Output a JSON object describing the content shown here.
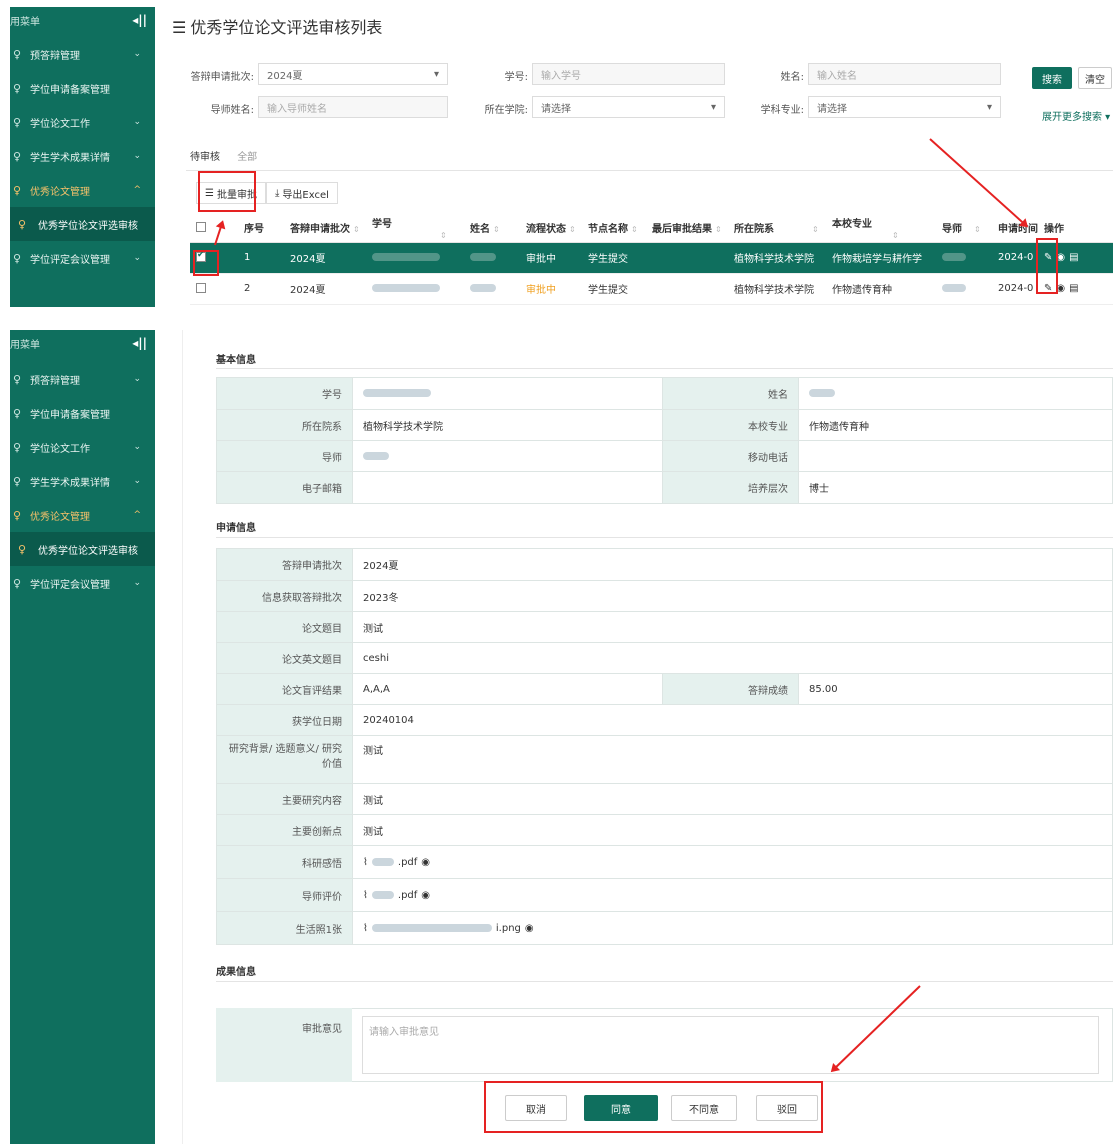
{
  "sidebar": {
    "header": "用菜单",
    "collapse": "◂||",
    "items": [
      {
        "label": "预答辩管理",
        "chev": "⌄"
      },
      {
        "label": "学位申请备案管理",
        "chev": ""
      },
      {
        "label": "学位论文工作",
        "chev": "⌄"
      },
      {
        "label": "学生学术成果详情",
        "chev": "⌄"
      },
      {
        "label": "优秀论文管理",
        "chev": "^"
      },
      {
        "label": "优秀学位论文评选审核",
        "chev": ""
      },
      {
        "label": "学位评定会议管理",
        "chev": "⌄"
      }
    ]
  },
  "page_title": "优秀学位论文评选审核列表",
  "filters": {
    "batch_label": "答辩申请批次:",
    "batch_value": "2024夏",
    "xuehao_label": "学号:",
    "xuehao_placeholder": "输入学号",
    "name_label": "姓名:",
    "name_placeholder": "输入姓名",
    "tutor_label": "导师姓名:",
    "tutor_placeholder": "输入导师姓名",
    "college_label": "所在学院:",
    "college_value": "请选择",
    "major_label": "学科专业:",
    "major_value": "请选择",
    "search": "搜索",
    "clear": "清空",
    "more": "展开更多搜索 ▾"
  },
  "tabs": [
    "待审核",
    "全部"
  ],
  "toolbar": {
    "batch_approve": "批量审批",
    "export": "导出Excel"
  },
  "table": {
    "headers": [
      "序号",
      "答辩申请批次",
      "学号",
      "姓名",
      "流程状态",
      "节点名称",
      "最后审批结果",
      "所在院系",
      "本校专业",
      "导师",
      "申请时间",
      "操作"
    ],
    "rows": [
      {
        "no": "1",
        "batch": "2024夏",
        "status": "审批中",
        "node": "学生提交",
        "result": "",
        "college": "植物科学技术学院",
        "major": "作物栽培学与耕作学",
        "time": "2024-0"
      },
      {
        "no": "2",
        "batch": "2024夏",
        "status": "审批中",
        "node": "学生提交",
        "result": "",
        "college": "植物科学技术学院",
        "major": "作物遗传育种",
        "time": "2024-0"
      }
    ]
  },
  "detail": {
    "basic_title": "基本信息",
    "basic": {
      "xuehao": "学号",
      "name": "姓名",
      "college": "所在院系",
      "college_val": "植物科学技术学院",
      "major": "本校专业",
      "major_val": "作物遗传育种",
      "tutor": "导师",
      "phone": "移动电话",
      "email": "电子邮箱",
      "level": "培养层次",
      "level_val": "博士"
    },
    "apply_title": "申请信息",
    "apply": {
      "batch": "答辩申请批次",
      "batch_val": "2024夏",
      "info_batch": "信息获取答辩批次",
      "info_batch_val": "2023冬",
      "topic": "论文题目",
      "topic_val": "测试",
      "en_topic": "论文英文题目",
      "en_topic_val": "ceshi",
      "blind": "论文盲评结果",
      "blind_val": "A,A,A",
      "score": "答辩成绩",
      "score_val": "85.00",
      "degree_date": "获学位日期",
      "degree_date_val": "20240104",
      "background": "研究背景/ 选题意义/ 研究价值",
      "background_val": "测试",
      "content": "主要研究内容",
      "content_val": "测试",
      "innovation": "主要创新点",
      "innovation_val": "测试",
      "feeling": "科研感悟",
      "feeling_file": ".pdf",
      "tutor_eval": "导师评价",
      "tutor_eval_file": ".pdf",
      "photo": "生活照1张",
      "photo_file": "i.png"
    },
    "result_title": "成果信息",
    "opinion_label": "审批意见",
    "opinion_placeholder": "请输入审批意见",
    "buttons": {
      "cancel": "取消",
      "agree": "同意",
      "disagree": "不同意",
      "reject": "驳回"
    }
  },
  "colors": {
    "primary": "#0f6f5e",
    "highlight": "#e52222",
    "status": "#f0a020"
  }
}
